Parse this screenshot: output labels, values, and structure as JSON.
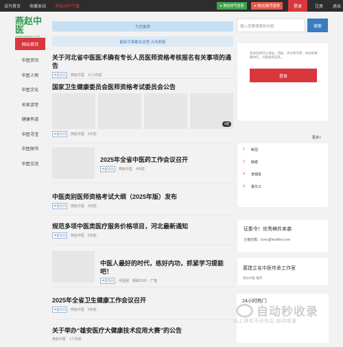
{
  "topbar": {
    "links": [
      "设为首页",
      "收藏本站",
      "手机APP下载"
    ],
    "wechat_login": "微信账号登录",
    "qq_login": "用QQ账号登录",
    "login": "登录",
    "register": "注册",
    "exit": "退出"
  },
  "logo": {
    "zh": "燕赵中医",
    "en": "YANZHAOZHONGYI.COM"
  },
  "sidenav": [
    "网站首页",
    "中医资讯",
    "中医人物",
    "中医文化",
    "名家讲堂",
    "健康有道",
    "中医寻宝",
    "中医图书",
    "中医交流"
  ],
  "tabs": {
    "recommend": "为您推荐",
    "new": "最新文章都在这里  点击刷新"
  },
  "articles": [
    {
      "title": "关于河北省中医医术确有专长人员医师资格考核报名有关事项的通告",
      "tag": "中医资讯",
      "source": "燕赵中医",
      "time": "17小时前"
    },
    {
      "title": "国家卫生健康委员会医师资格考试委员会公告",
      "tag": "中医资讯",
      "source": "燕赵中医",
      "time": "4天前",
      "img_count": "6图"
    },
    {
      "title": "2025年全省中医药工作会议召开",
      "tag": "中医资讯",
      "source": "燕赵中医",
      "time": "4天前"
    },
    {
      "title": "中医类别医师资格考试大纲（2025年版）发布",
      "tag": "中医资讯",
      "source": "燕赵中医",
      "time": "4天前"
    },
    {
      "title": "规范多项中医类医疗服务价格项目，河北最新通知",
      "tag": "中医资讯",
      "source": "燕赵中医",
      "time": "5天前"
    },
    {
      "title": "中医人最好的时代，练好内功，抓紧学习提能吧！",
      "tag": "中医资讯",
      "source": "中医圈",
      "extra": "順館2020",
      "ad": "广告"
    },
    {
      "title": "2025年全省卫生健康工作会议召开",
      "tag": "中医资讯",
      "source": "燕赵中医",
      "time": "5天前"
    },
    {
      "title": "关于举办“雄安医疗大健康技术应用大赛”的公告",
      "tag": "",
      "source": "燕赵中医",
      "time": "1个月前"
    }
  ],
  "search": {
    "placeholder": "输入您要搜索的内容",
    "button": "搜索"
  },
  "login_box": {
    "desc": "登录后即可以发帖、回帖、评论和点赞，体验如果随时忆，尽量发布信息。",
    "button": "登录"
  },
  "more": "更多>",
  "hot": [
    {
      "n": "1",
      "label": "新冠"
    },
    {
      "n": "2",
      "label": "肺癌"
    },
    {
      "n": "3",
      "label": "李佃贵"
    },
    {
      "n": "4",
      "label": "赛华义"
    }
  ],
  "ad1": {
    "title": "征集令！优秀稿件来袭",
    "sub": "主编信箱：tcmc@healthcn.net"
  },
  "ad2": {
    "title": "葛建立名中医传承工作室",
    "sub": "燕赵中医  推荐"
  },
  "h24": {
    "title": "24小时热门"
  },
  "watermark": {
    "big": "自动秒收录",
    "small": "以上排名不分先后  自动收录"
  }
}
